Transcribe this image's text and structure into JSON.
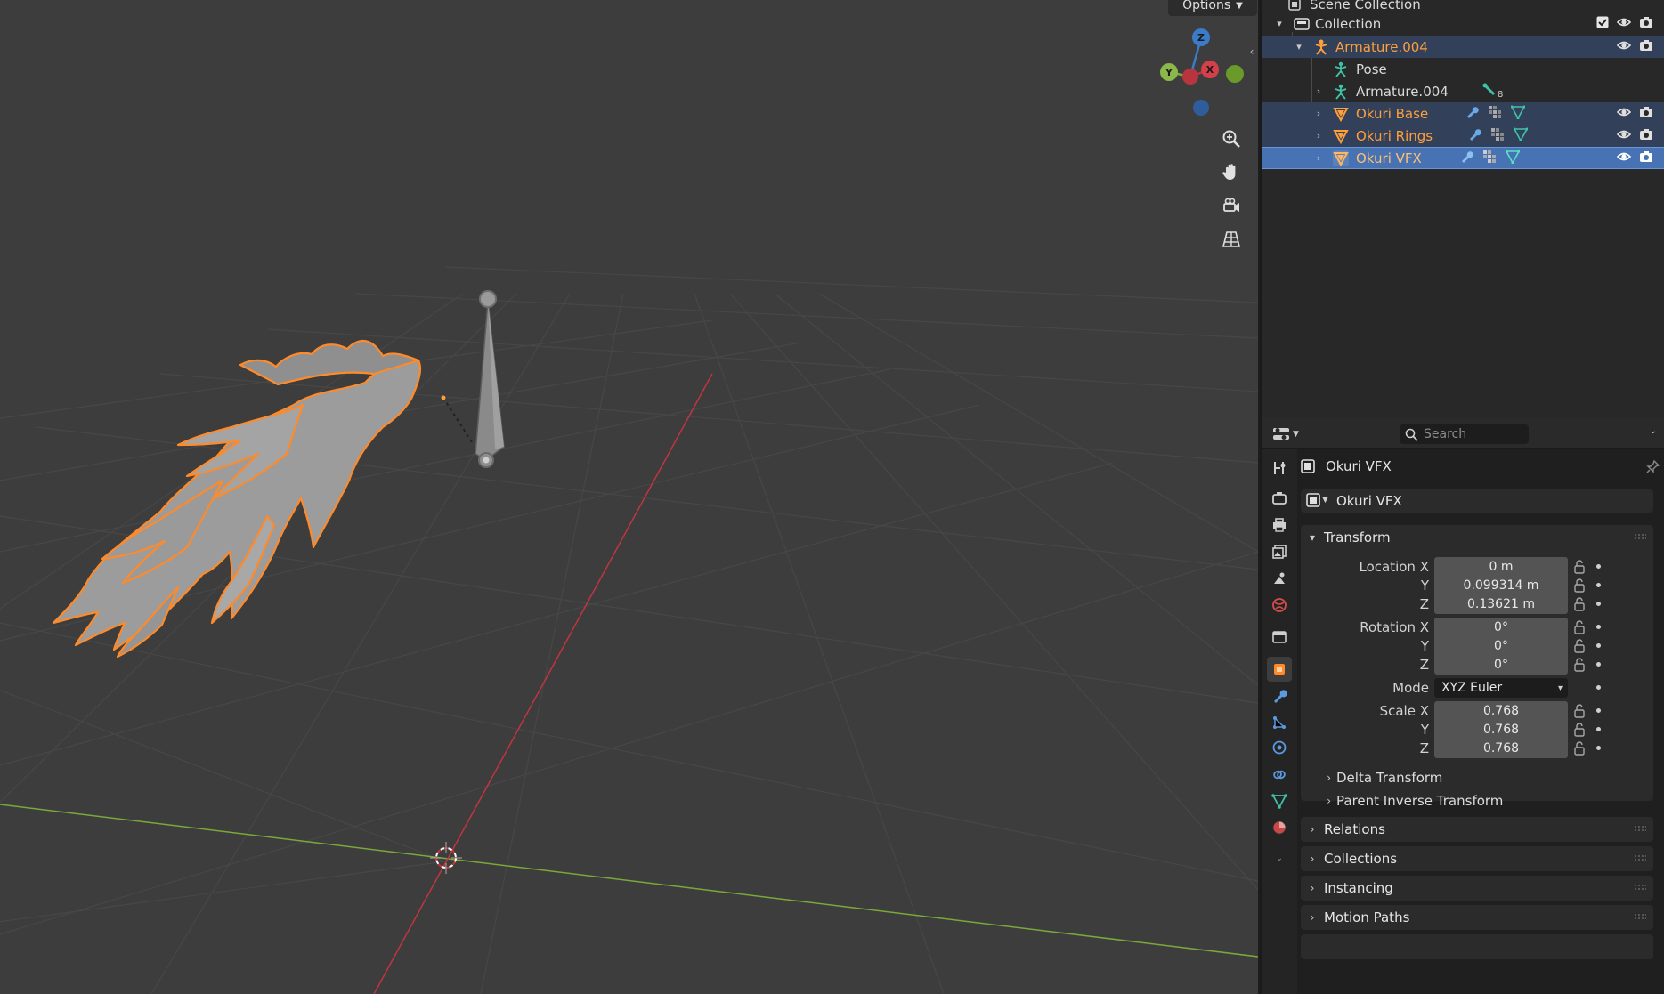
{
  "viewport": {
    "options_label": "Options"
  },
  "gizmo": {
    "axis_z": "Z",
    "axis_y": "Y",
    "axis_x": "X"
  },
  "outliner": {
    "scene_collection": "Scene Collection",
    "rows": [
      {
        "label": "Collection"
      },
      {
        "label": "Armature.004"
      },
      {
        "label": "Pose"
      },
      {
        "label": "Armature.004",
        "badge": "8"
      },
      {
        "label": "Okuri Base"
      },
      {
        "label": "Okuri Rings"
      },
      {
        "label": "Okuri VFX"
      }
    ]
  },
  "properties": {
    "search_placeholder": "Search",
    "object_title": "Okuri VFX",
    "object_name": "Okuri VFX",
    "transform": {
      "title": "Transform",
      "location_label": "Location X",
      "location": [
        "0 m",
        "0.099314 m",
        "0.13621 m"
      ],
      "rotation_label": "Rotation X",
      "rotation": [
        "0°",
        "0°",
        "0°"
      ],
      "mode_label": "Mode",
      "mode_value": "XYZ Euler",
      "scale_label": "Scale X",
      "scale": [
        "0.768",
        "0.768",
        "0.768"
      ],
      "y_label": "Y",
      "z_label": "Z",
      "delta_transform": "Delta Transform",
      "parent_inverse": "Parent Inverse Transform"
    },
    "panels": [
      "Relations",
      "Collections",
      "Instancing",
      "Motion Paths"
    ]
  },
  "colors": {
    "accent_blue": "#4772b3",
    "selection_orange": "#ff9f3a",
    "viewport_bg": "#3d3d3d",
    "axis_red": "#c0353f",
    "axis_green": "#7aa83a"
  }
}
